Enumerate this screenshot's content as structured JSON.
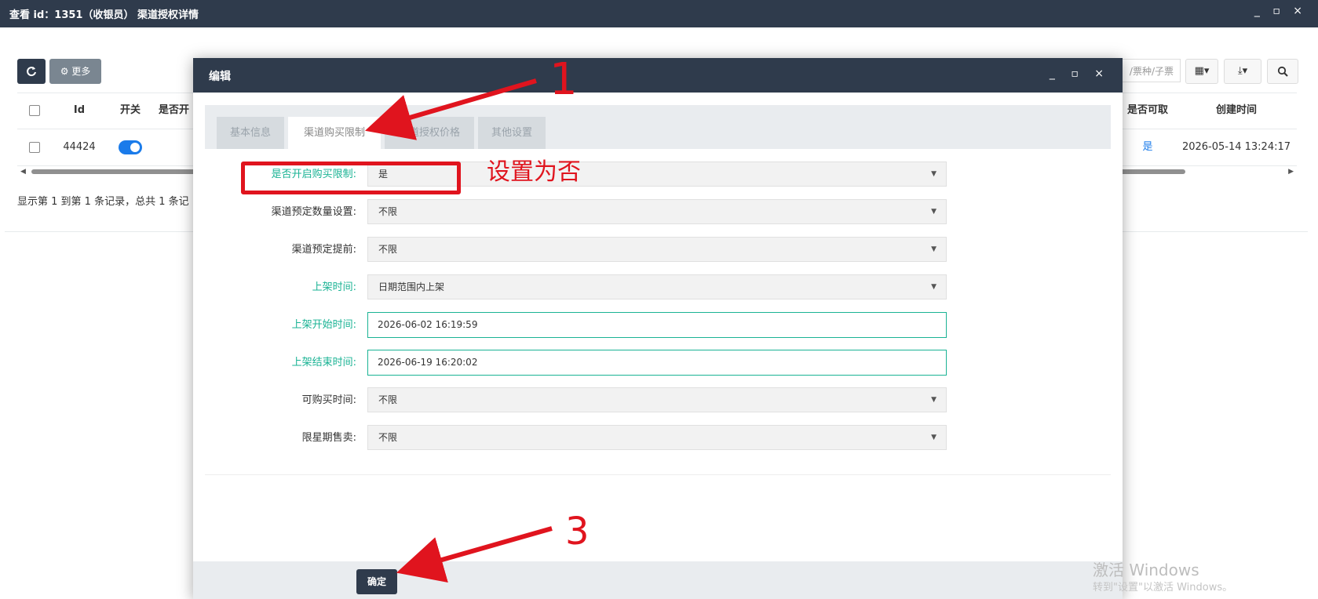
{
  "window": {
    "title": "查看 id：1351（收银员） 渠道授权详情",
    "controls": "_ ▫ ×"
  },
  "background": {
    "toolbar": {
      "refresh_icon": "refresh-icon",
      "more_label": "⚙ 更多",
      "search_placeholder": "/票种/子票",
      "columns_label": "▦▾",
      "export_label": "⤓▾",
      "search_icon": "🔍"
    },
    "table": {
      "headers": [
        "",
        "Id",
        "开关",
        "是否开",
        "是否可取",
        "创建时间"
      ],
      "row": {
        "id": "44424",
        "enabled": true,
        "can_take": "是",
        "created": "2026-05-14 13:24:17"
      }
    },
    "summary": "显示第 1 到第 1 条记录，总共 1 条记"
  },
  "modal": {
    "title": "编辑",
    "controls": "_ ▫ ×",
    "tabs": [
      {
        "label": "基本信息",
        "active": false
      },
      {
        "label": "渠道购买限制",
        "active": true
      },
      {
        "label": "渠道授权价格",
        "active": false
      },
      {
        "label": "其他设置",
        "active": false
      }
    ],
    "fields": [
      {
        "label": "是否开启购买限制:",
        "value": "是",
        "type": "select",
        "highlight": true
      },
      {
        "label": "渠道预定数量设置:",
        "value": "不限",
        "type": "select",
        "highlight": false
      },
      {
        "label": "渠道预定提前:",
        "value": "不限",
        "type": "select",
        "highlight": false
      },
      {
        "label": "上架时间:",
        "value": "日期范围内上架",
        "type": "select",
        "highlight": true
      },
      {
        "label": "上架开始时间:",
        "value": "2026-06-02 16:19:59",
        "type": "input",
        "highlight": true
      },
      {
        "label": "上架结束时间:",
        "value": "2026-06-19 16:20:02",
        "type": "input",
        "highlight": true
      },
      {
        "label": "可购买时间:",
        "value": "不限",
        "type": "select",
        "highlight": false
      },
      {
        "label": "限星期售卖:",
        "value": "不限",
        "type": "select",
        "highlight": false
      }
    ],
    "confirm_label": "确定"
  },
  "annotations": {
    "step1": "1",
    "note": "设置为否",
    "step3": "3",
    "color": "#e0141e"
  },
  "watermark": {
    "line1": "激活 Windows",
    "line2": "转到\"设置\"以激活 Windows。"
  },
  "colors": {
    "header_bg": "#2f3b4c",
    "accent_green": "#1ab394",
    "toggle_blue": "#1a7bea"
  }
}
